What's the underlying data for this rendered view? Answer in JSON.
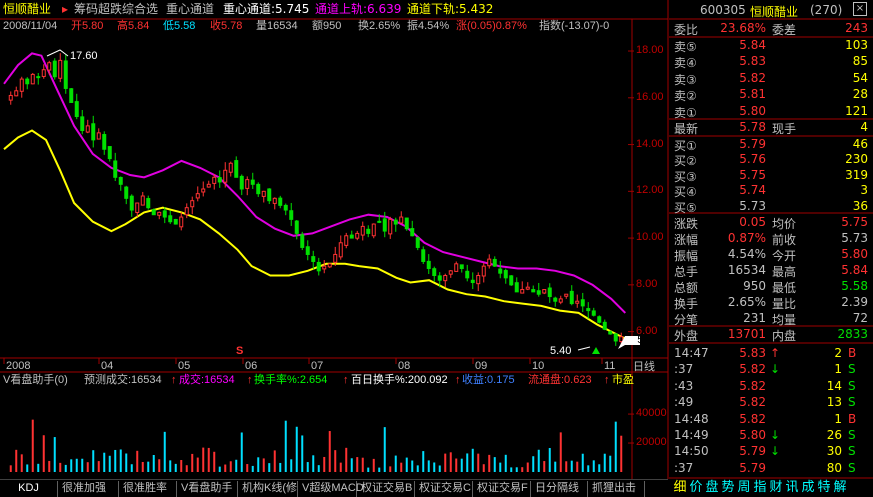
{
  "header": {
    "stock_name": "恒顺醋业",
    "indicator_title": "筹码超跌综合选",
    "center_line": "重心通道",
    "center_value": "重心通道:5.745",
    "upper_value": "通道上轨:6.639",
    "lower_value": "通道下轨:5.432"
  },
  "quote_line": {
    "date": "2008/11/04",
    "open": "开5.80",
    "high": "高5.84",
    "low": "低5.58",
    "close": "收5.78",
    "volume": "量16534",
    "amount": "额950",
    "turnover": "换2.65%",
    "amplitude": "振4.54%",
    "change": "涨(0.05)0.87%",
    "index": "指数(-13.07)-0"
  },
  "price_axis": {
    "ticks": [
      "18.00",
      "16.00",
      "14.00",
      "12.00",
      "10.00",
      "8.00",
      "6.00"
    ],
    "current_price": "5.78"
  },
  "annotations": {
    "max_label": "17.60",
    "min_label": "5.40",
    "marker": "S"
  },
  "time_axis": [
    "2008",
    "04",
    "05",
    "06",
    "07",
    "08",
    "09",
    "10",
    "11"
  ],
  "daily_label": "日线",
  "volume_panel": {
    "title": "V看盘助手(0)",
    "predict": "预测成交:16534",
    "cj": "成交:16534",
    "turnover_rate": "换手率%:2.654",
    "hundred_day": "百日换手%:200.092",
    "profit": "收益:0.175",
    "flow": "流通盘:0.623",
    "market": "市盈",
    "ticks": [
      "40000",
      "20000"
    ]
  },
  "right_panel": {
    "code": "600305",
    "name": "恒顺醋业",
    "count": "(270)",
    "weibi_label": "委比",
    "weibi": "23.68%",
    "weicha_label": "委差",
    "weicha": "243",
    "asks": [
      {
        "label": "卖⑤",
        "price": "5.84",
        "vol": "103"
      },
      {
        "label": "卖④",
        "price": "5.83",
        "vol": "85"
      },
      {
        "label": "卖③",
        "price": "5.82",
        "vol": "54"
      },
      {
        "label": "卖②",
        "price": "5.81",
        "vol": "28"
      },
      {
        "label": "卖①",
        "price": "5.80",
        "vol": "121"
      }
    ],
    "latest_label": "最新",
    "latest": "5.78",
    "xianshou_label": "现手",
    "xianshou": "4",
    "bids": [
      {
        "label": "买①",
        "price": "5.79",
        "vol": "46"
      },
      {
        "label": "买②",
        "price": "5.76",
        "vol": "230"
      },
      {
        "label": "买③",
        "price": "5.75",
        "vol": "319"
      },
      {
        "label": "买④",
        "price": "5.74",
        "vol": "3"
      },
      {
        "label": "买⑤",
        "price": "5.73",
        "vol": "36"
      }
    ],
    "stats": [
      {
        "l1": "涨跌",
        "v1": "0.05",
        "l2": "均价",
        "v2": "5.75"
      },
      {
        "l1": "涨幅",
        "v1": "0.87%",
        "l2": "前收",
        "v2": "5.73"
      },
      {
        "l1": "振幅",
        "v1": "4.54%",
        "l2": "今开",
        "v2": "5.80"
      },
      {
        "l1": "总手",
        "v1": "16534",
        "l2": "最高",
        "v2": "5.84"
      },
      {
        "l1": "总额",
        "v1": "950",
        "l2": "最低",
        "v2": "5.58"
      },
      {
        "l1": "换手",
        "v1": "2.65%",
        "l2": "量比",
        "v2": "2.39"
      },
      {
        "l1": "分笔",
        "v1": "231",
        "l2": "均量",
        "v2": "72"
      }
    ],
    "waipan_label": "外盘",
    "waipan": "13701",
    "neipan_label": "内盘",
    "neipan": "2833",
    "ticks": [
      {
        "time": "14:47",
        "price": "5.83",
        "arrow": "↑",
        "vol": "2",
        "bs": "B"
      },
      {
        "time": ":37",
        "price": "5.82",
        "arrow": "↓",
        "vol": "1",
        "bs": "S"
      },
      {
        "time": ":43",
        "price": "5.82",
        "arrow": "",
        "vol": "14",
        "bs": "S"
      },
      {
        "time": ":49",
        "price": "5.82",
        "arrow": "",
        "vol": "13",
        "bs": "S"
      },
      {
        "time": "14:48",
        "price": "5.82",
        "arrow": "",
        "vol": "1",
        "bs": "B"
      },
      {
        "time": "14:49",
        "price": "5.80",
        "arrow": "↓",
        "vol": "26",
        "bs": "S"
      },
      {
        "time": "14:50",
        "price": "5.79",
        "arrow": "↓",
        "vol": "30",
        "bs": "S"
      },
      {
        "time": ":37",
        "price": "5.79",
        "arrow": "",
        "vol": "80",
        "bs": "S"
      }
    ]
  },
  "bottom_tabs": [
    "KDJ",
    "很准加强",
    "很准胜率",
    "V看盘助手",
    "机构K线(修",
    "V超级MACD",
    "权证交易B",
    "权证交易C",
    "权证交易F",
    "日分隔线",
    "抓狸出击"
  ],
  "right_tabs": [
    "细",
    "价",
    "盘",
    "势",
    "周",
    "指",
    "财",
    "讯",
    "成",
    "特",
    "解"
  ],
  "colors": {
    "up": "#ff3232",
    "down": "#00e000",
    "upper": "#e000e0",
    "mid": "#ffff00",
    "axis": "#a00000",
    "cyan": "#00ffff"
  },
  "chart_data": {
    "type": "candlestick",
    "title": "恒顺醋业 日线",
    "x_range": [
      "2008-01",
      "2008-11"
    ],
    "month_labels": [
      "2008",
      "04",
      "05",
      "06",
      "07",
      "08",
      "09",
      "10",
      "11"
    ],
    "ylim": [
      5.0,
      18.6
    ],
    "upper_band": [
      [
        0,
        16.6
      ],
      [
        6,
        17.4
      ],
      [
        12,
        17.9
      ],
      [
        16,
        17.8
      ],
      [
        22,
        16.5
      ],
      [
        30,
        14.8
      ],
      [
        38,
        13.6
      ],
      [
        46,
        13.0
      ],
      [
        54,
        12.7
      ],
      [
        60,
        12.6
      ],
      [
        68,
        12.9
      ],
      [
        76,
        13.3
      ],
      [
        84,
        13.0
      ],
      [
        92,
        12.6
      ],
      [
        100,
        11.8
      ],
      [
        108,
        10.9
      ],
      [
        116,
        10.4
      ],
      [
        124,
        10.1
      ],
      [
        132,
        10.2
      ],
      [
        140,
        10.5
      ],
      [
        148,
        10.8
      ],
      [
        156,
        11.0
      ],
      [
        164,
        10.9
      ],
      [
        172,
        10.5
      ],
      [
        180,
        9.8
      ],
      [
        188,
        9.4
      ],
      [
        196,
        9.2
      ],
      [
        204,
        9.0
      ],
      [
        212,
        8.8
      ],
      [
        220,
        8.7
      ],
      [
        228,
        8.7
      ],
      [
        236,
        8.6
      ],
      [
        244,
        8.4
      ],
      [
        252,
        8.0
      ],
      [
        260,
        7.4
      ],
      [
        266,
        6.8
      ]
    ],
    "mid_band": [
      [
        0,
        13.8
      ],
      [
        6,
        14.3
      ],
      [
        12,
        14.6
      ],
      [
        18,
        14.2
      ],
      [
        24,
        12.9
      ],
      [
        30,
        11.5
      ],
      [
        38,
        10.7
      ],
      [
        46,
        10.3
      ],
      [
        52,
        10.6
      ],
      [
        60,
        11.1
      ],
      [
        68,
        11.3
      ],
      [
        76,
        11.1
      ],
      [
        84,
        10.8
      ],
      [
        92,
        10.2
      ],
      [
        100,
        9.5
      ],
      [
        106,
        8.8
      ],
      [
        114,
        8.4
      ],
      [
        122,
        8.4
      ],
      [
        130,
        8.6
      ],
      [
        138,
        8.9
      ],
      [
        146,
        8.9
      ],
      [
        152,
        8.8
      ],
      [
        160,
        8.7
      ],
      [
        168,
        8.3
      ],
      [
        174,
        8.1
      ],
      [
        182,
        8.2
      ],
      [
        190,
        7.8
      ],
      [
        198,
        7.6
      ],
      [
        206,
        7.5
      ],
      [
        214,
        7.3
      ],
      [
        222,
        7.2
      ],
      [
        230,
        7.1
      ],
      [
        238,
        6.9
      ],
      [
        246,
        6.8
      ],
      [
        254,
        6.3
      ],
      [
        262,
        5.9
      ],
      [
        266,
        5.7
      ]
    ],
    "closes": [
      16.1,
      16.3,
      16.8,
      16.6,
      17.0,
      16.9,
      17.2,
      17.5,
      16.9,
      17.6,
      16.4,
      15.8,
      15.2,
      14.6,
      14.8,
      14.2,
      14.5,
      13.8,
      13.4,
      12.6,
      12.3,
      11.7,
      11.2,
      11.5,
      11.8,
      11.3,
      11.0,
      11.1,
      10.9,
      10.7,
      10.6,
      10.9,
      11.3,
      11.6,
      11.9,
      12.1,
      12.3,
      12.6,
      12.4,
      12.9,
      13.2,
      12.6,
      12.1,
      12.5,
      12.3,
      11.9,
      12.0,
      11.6,
      11.7,
      11.4,
      11.2,
      10.8,
      10.2,
      9.6,
      9.3,
      9.0,
      8.6,
      8.8,
      8.9,
      9.3,
      9.8,
      10.1,
      10.0,
      10.2,
      10.5,
      10.2,
      10.6,
      10.7,
      10.3,
      10.8,
      10.6,
      10.9,
      10.4,
      10.1,
      9.6,
      9.0,
      8.7,
      8.4,
      8.2,
      8.4,
      8.6,
      8.9,
      8.7,
      8.3,
      8.1,
      8.4,
      8.8,
      9.1,
      8.8,
      8.5,
      8.3,
      8.0,
      7.7,
      7.8,
      7.9,
      7.7,
      7.6,
      7.8,
      7.5,
      7.3,
      7.4,
      7.6,
      7.2,
      7.3,
      7.1,
      6.9,
      6.7,
      6.4,
      6.1,
      5.9,
      5.6,
      5.78
    ],
    "volume_ylim": [
      0,
      58000
    ]
  }
}
